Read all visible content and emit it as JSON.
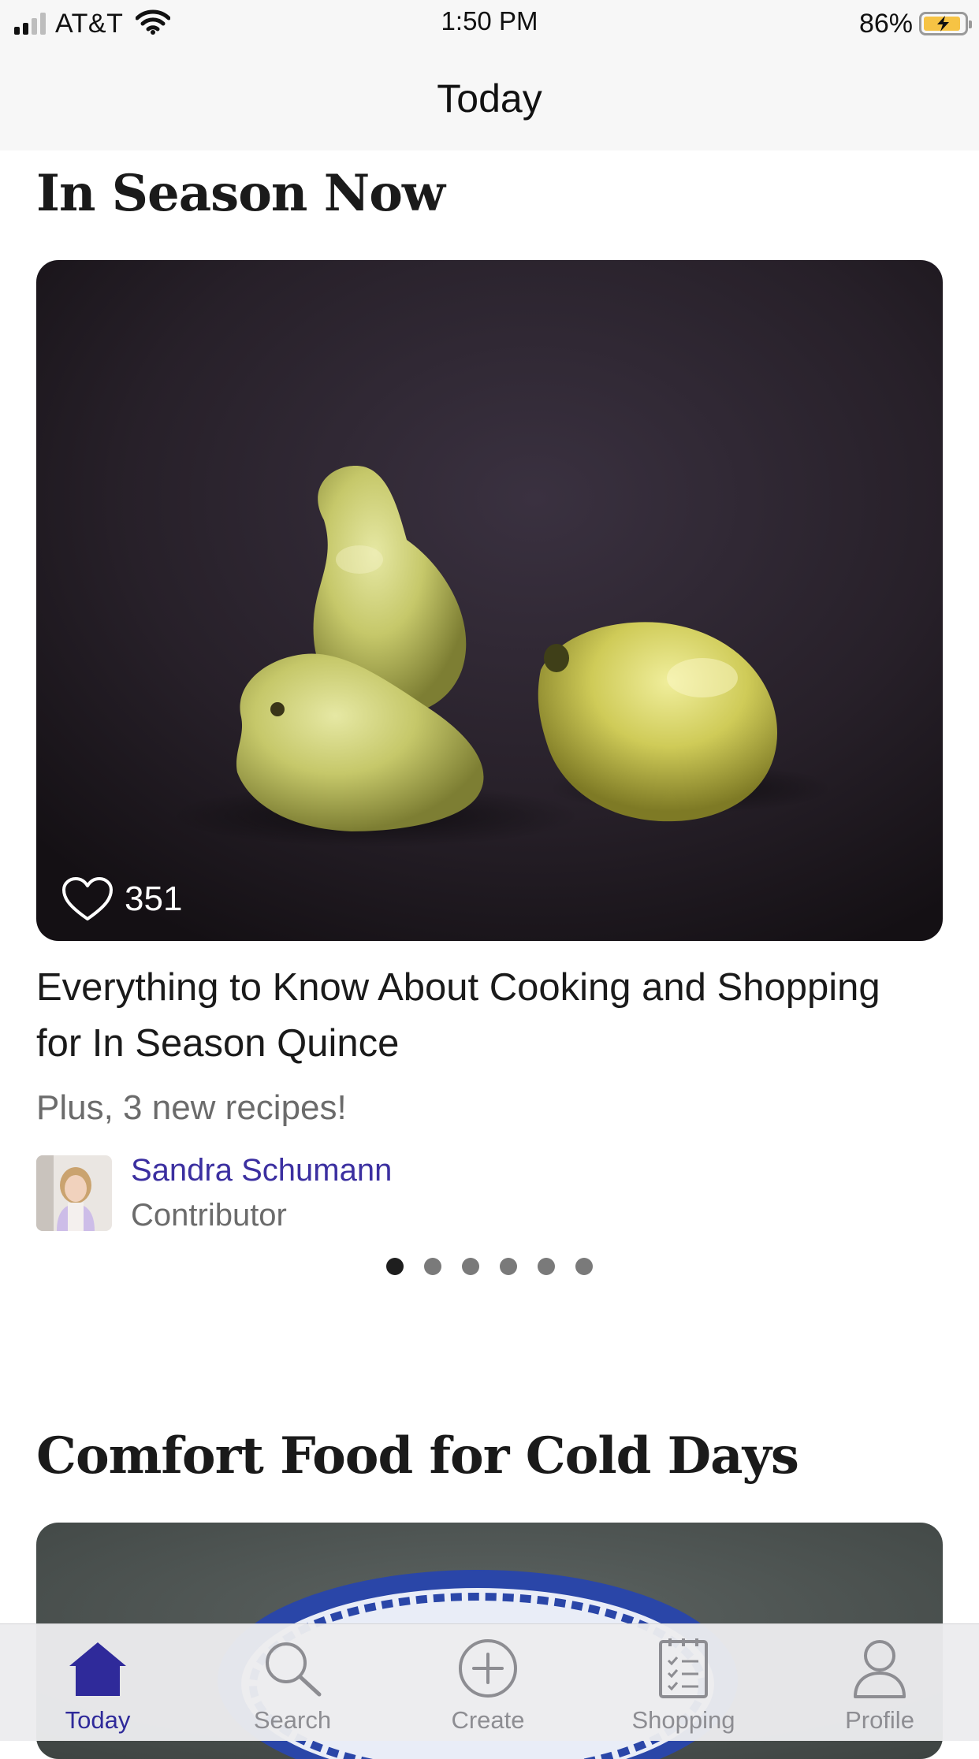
{
  "status_bar": {
    "carrier": "AT&T",
    "time": "1:50 PM",
    "battery_percent": "86%",
    "battery_level": 0.86,
    "charging": true
  },
  "nav": {
    "title": "Today"
  },
  "section_in_season": {
    "heading": "In Season Now",
    "card": {
      "image": "quince-photo",
      "like_count": "351",
      "title": "Everything to Know About Cooking and Shopping for In Season Quince",
      "subtitle": "Plus, 3 new recipes!",
      "author_name": "Sandra Schumann",
      "author_role": "Contributor"
    },
    "pagination": {
      "count": 6,
      "active_index": 0
    }
  },
  "section_comfort": {
    "heading": "Comfort Food for Cold Days",
    "image": "blue-white-plate-photo"
  },
  "tab_bar": {
    "tabs": [
      {
        "label": "Today",
        "icon": "home-icon",
        "active": true
      },
      {
        "label": "Search",
        "icon": "search-icon",
        "active": false
      },
      {
        "label": "Create",
        "icon": "plus-circle-icon",
        "active": false
      },
      {
        "label": "Shopping",
        "icon": "checklist-icon",
        "active": false
      },
      {
        "label": "Profile",
        "icon": "person-icon",
        "active": false
      }
    ]
  },
  "colors": {
    "accent": "#2f2a9a",
    "author_link": "#3b2fa0",
    "battery_fill": "#f6c344"
  }
}
